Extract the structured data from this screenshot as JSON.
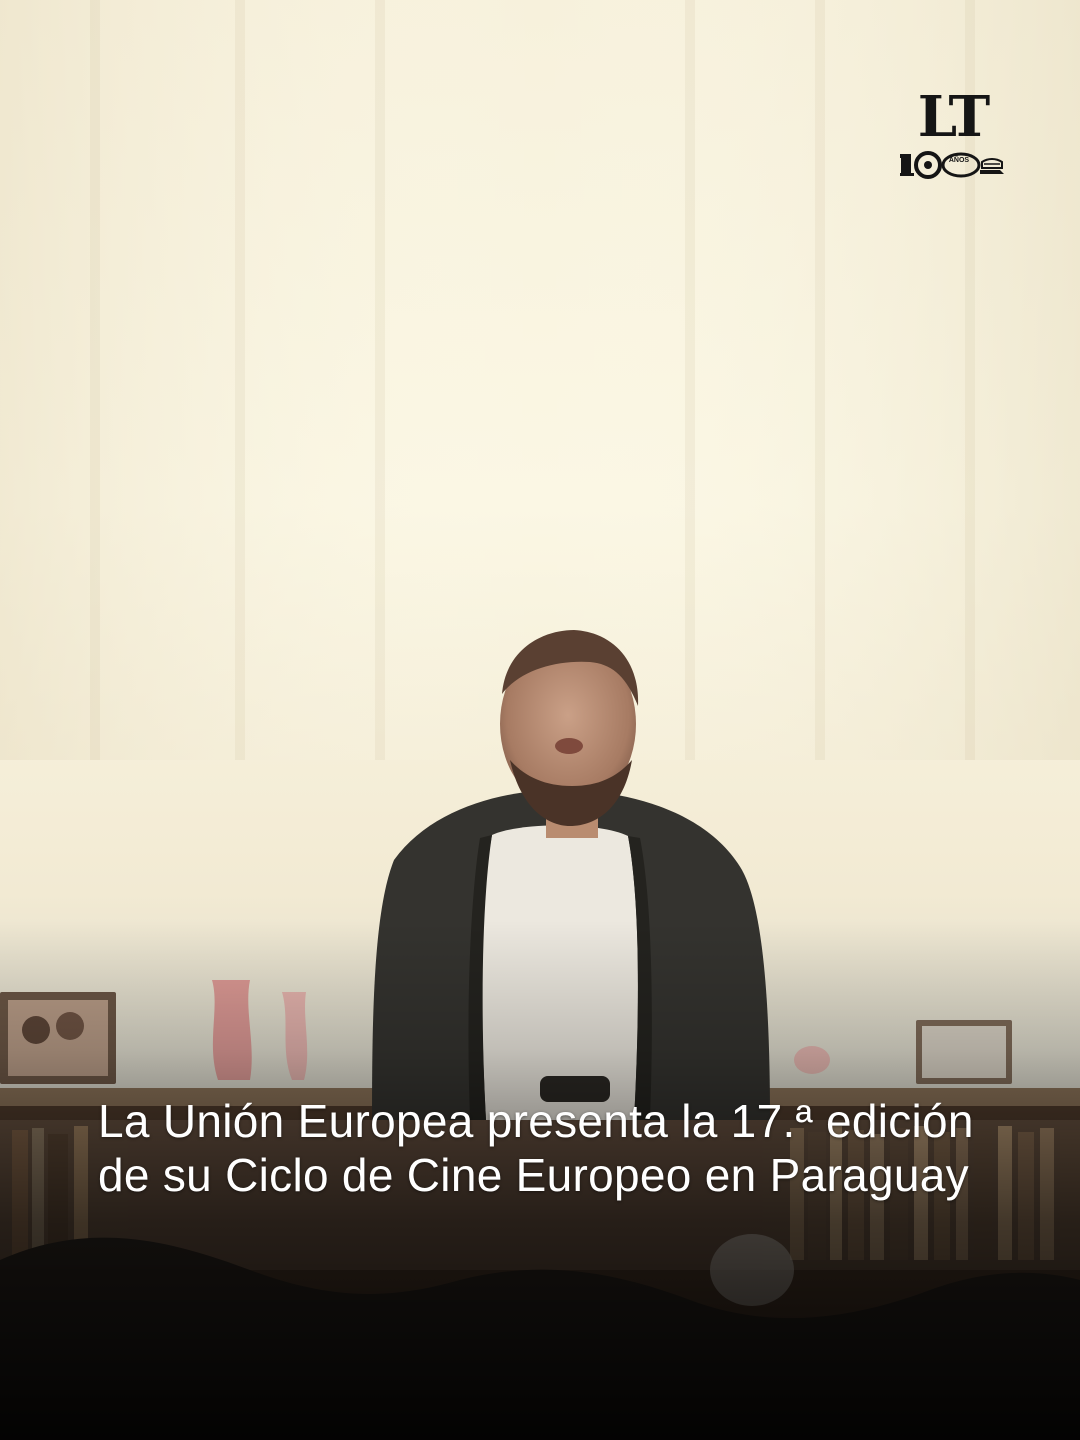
{
  "brand": {
    "logo_letters": "LT",
    "anniversary_number": "100",
    "anniversary_label": "AÑOS"
  },
  "headline": "La Unión Europea presenta la 17.ª edición de su Ciclo de Cine Europeo en Paraguay",
  "colors": {
    "background": "#f6f1dd",
    "headline_text": "#ffffff",
    "logo": "#151515"
  },
  "icons": {
    "logo": "lt-100-anos-logo"
  }
}
